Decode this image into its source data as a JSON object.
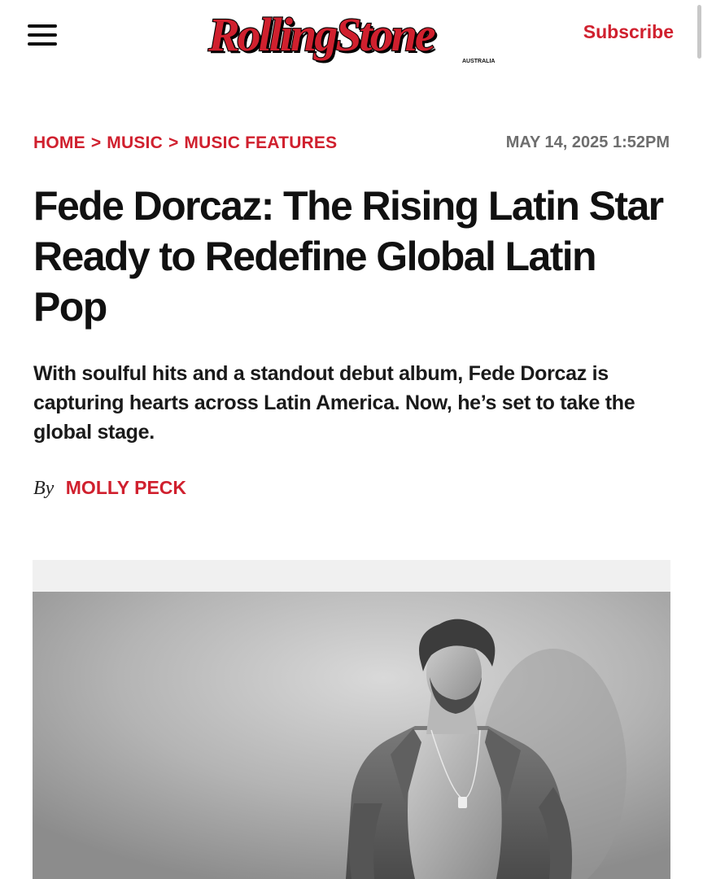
{
  "header": {
    "menu_icon": "hamburger-menu-icon",
    "logo_text": "RollingStone",
    "logo_sub": "AUSTRALIA",
    "subscribe_label": "Subscribe",
    "brand_color": "#d0202e"
  },
  "breadcrumb": {
    "items": [
      "HOME",
      "MUSIC",
      "MUSIC FEATURES"
    ],
    "separator": ">"
  },
  "dateline": "MAY 14, 2025 1:52PM",
  "article": {
    "headline": "Fede Dorcaz: The Rising Latin Star Ready to Redefine Global Latin Pop",
    "dek": "With soulful hits and a standout debut album, Fede Dorcaz is capturing hearts across Latin America. Now, he’s set to take the global stage.",
    "byline_prefix": "By",
    "author": "MOLLY PECK"
  },
  "hero_image": {
    "style": "black-and-white portrait"
  }
}
